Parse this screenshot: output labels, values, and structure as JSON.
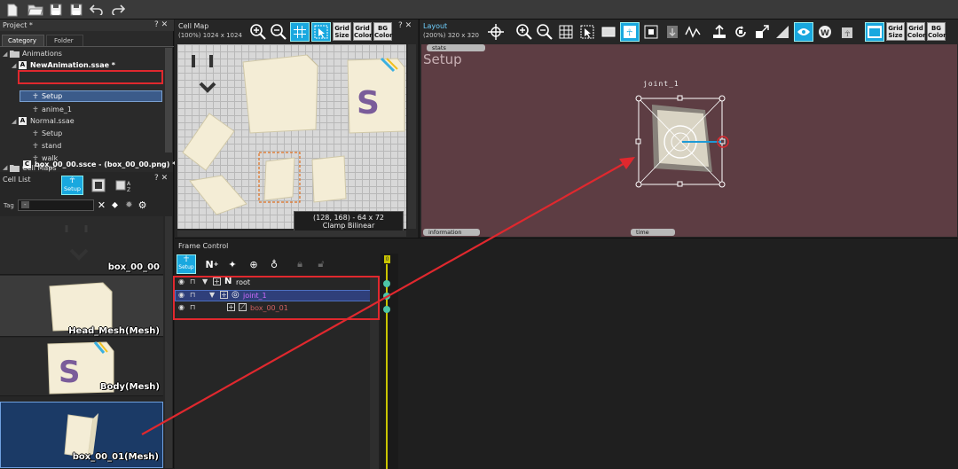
{
  "project": {
    "title": "Project *",
    "tabs": [
      "Category",
      "Folder"
    ],
    "tree": [
      {
        "label": "Animations"
      },
      {
        "label": "NewAnimation.ssae *"
      },
      {
        "label": "Setup"
      },
      {
        "label": "anime_1"
      },
      {
        "label": "Normal.ssae"
      },
      {
        "label": "Setup"
      },
      {
        "label": "stand"
      },
      {
        "label": "walk"
      },
      {
        "label": "Cell Maps"
      },
      {
        "label": "box_00_00.ssce - (box_00_00.png) *"
      }
    ]
  },
  "cell_list": {
    "title": "Cell List",
    "tag_label": "Tag",
    "tag_value": "-",
    "setup_label": "Setup",
    "items": [
      {
        "label": "box_00_00"
      },
      {
        "label": "Head_Mesh(Mesh)"
      },
      {
        "label": "Body(Mesh)"
      },
      {
        "label": "box_00_01(Mesh)"
      }
    ]
  },
  "cell_map": {
    "title": "Cell Map",
    "info": "(100%) 1024 x 1024",
    "grid_size": [
      "Grid",
      "Size"
    ],
    "grid_color": [
      "Grid",
      "Color"
    ],
    "bg_color": [
      "BG",
      "Color"
    ],
    "status_line1": "(128, 168) - 64 x 72",
    "status_line2": "Clamp  Bilinear"
  },
  "layout": {
    "title": "Layout",
    "info": "(200%) 320 x 320",
    "stats_tab": "stats",
    "setup_text": "Setup",
    "joint_label": "joint_1",
    "info_tab": "information",
    "time_tab": "time",
    "grid_size": [
      "Grid",
      "Size"
    ],
    "grid_color": [
      "Grid",
      "Color"
    ],
    "bg_color": [
      "BG",
      "Color"
    ],
    "bg_hex": "#5d3d43"
  },
  "frame_control": {
    "title": "Frame Control",
    "setup_label": "Setup",
    "frame_number": "0",
    "parts": [
      {
        "label": "root"
      },
      {
        "label": "joint_1"
      },
      {
        "label": "box_00_01"
      }
    ]
  },
  "colors": {
    "highlight_red": "#e0282e",
    "accent_blue": "#2b6fb6",
    "cyan_button": "#19a8df",
    "timeline_yellow": "#c9c400"
  }
}
